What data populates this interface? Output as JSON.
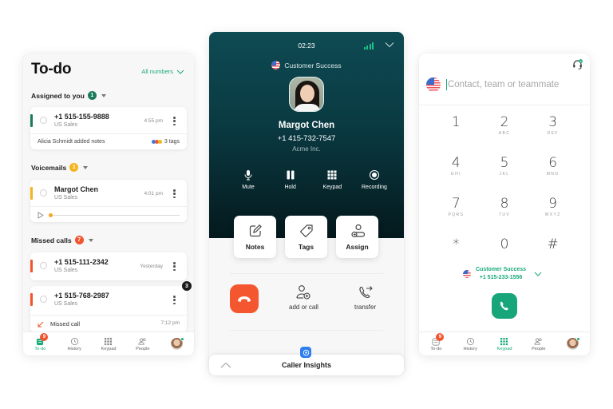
{
  "todo": {
    "title": "To-do",
    "filter_label": "All numbers",
    "sections": {
      "assigned": {
        "label": "Assigned to you",
        "count": "1",
        "color": "#1b7b5a",
        "item": {
          "number": "+1 515-155-9888",
          "line": "US Sales",
          "time": "4:55 pm",
          "note": "Alicia Schmidt added notes",
          "tags": "3 tags"
        }
      },
      "voicemails": {
        "label": "Voicemails",
        "count": "1",
        "color": "#f5b51e",
        "item": {
          "name": "Margot Chen",
          "line": "US Sales",
          "time": "4:01 pm",
          "playback_progress": 0
        }
      },
      "missed": {
        "label": "Missed calls",
        "count": "7",
        "color": "#f2542d",
        "items": [
          {
            "number": "+1 515-111-2342",
            "line": "US Sales",
            "time": "Yesterday"
          },
          {
            "number": "+1 515-768-2987",
            "line": "US Sales",
            "badge": "3",
            "detail": "Missed call",
            "detail_time": "7:12 pm"
          }
        ]
      }
    },
    "nav": [
      {
        "label": "To-do",
        "icon": "todo-icon",
        "badge": "9",
        "active": true
      },
      {
        "label": "History",
        "icon": "history-icon"
      },
      {
        "label": "Keypad",
        "icon": "keypad-icon"
      },
      {
        "label": "People",
        "icon": "people-icon"
      },
      {
        "label": "",
        "icon": "avatar"
      }
    ]
  },
  "call": {
    "timer": "02:23",
    "line_name": "Customer Success",
    "caller": {
      "name": "Margot Chen",
      "phone": "+1 415-732-7547",
      "company": "Acme Inc."
    },
    "controls": [
      {
        "label": "Mute",
        "icon": "microphone-icon"
      },
      {
        "label": "Hold",
        "icon": "pause-icon"
      },
      {
        "label": "Keypad",
        "icon": "keypad-icon"
      },
      {
        "label": "Recording",
        "icon": "record-icon"
      }
    ],
    "tiles": [
      {
        "label": "Notes",
        "icon": "notes-icon"
      },
      {
        "label": "Tags",
        "icon": "tag-icon"
      },
      {
        "label": "Assign",
        "icon": "assign-icon"
      }
    ],
    "actions": {
      "add_label": "add or call",
      "transfer_label": "transfer"
    },
    "insights_label": "Caller Insights",
    "colors": {
      "hangup": "#f4572f",
      "signal": "#1fc48d",
      "header_bg": "#0e4a53"
    }
  },
  "keypad": {
    "search_placeholder": "Contact, team or teammate",
    "keys": [
      {
        "digit": "1",
        "letters": ""
      },
      {
        "digit": "2",
        "letters": "ABC"
      },
      {
        "digit": "3",
        "letters": "DEF"
      },
      {
        "digit": "4",
        "letters": "GHI"
      },
      {
        "digit": "5",
        "letters": "JKL"
      },
      {
        "digit": "6",
        "letters": "MNO"
      },
      {
        "digit": "7",
        "letters": "PQRS"
      },
      {
        "digit": "8",
        "letters": "TUV"
      },
      {
        "digit": "9",
        "letters": "WXYZ"
      },
      {
        "digit": "*",
        "letters": ""
      },
      {
        "digit": "0",
        "letters": ""
      },
      {
        "digit": "#",
        "letters": ""
      }
    ],
    "line": {
      "name": "Customer Success",
      "number": "+1 515-233-1556"
    },
    "nav": [
      {
        "label": "To-do",
        "icon": "todo-icon",
        "badge": "9"
      },
      {
        "label": "History",
        "icon": "history-icon"
      },
      {
        "label": "Keypad",
        "icon": "keypad-icon",
        "active": true
      },
      {
        "label": "People",
        "icon": "people-icon"
      },
      {
        "label": "",
        "icon": "avatar"
      }
    ],
    "accent": "#19a97b"
  }
}
